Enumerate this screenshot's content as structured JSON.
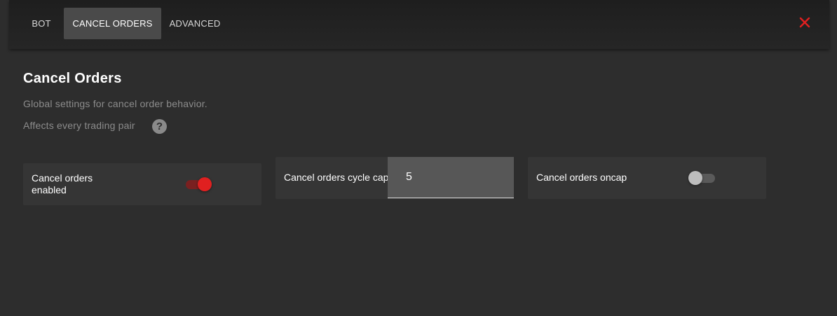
{
  "tabs": [
    {
      "label": "BOT",
      "active": false
    },
    {
      "label": "CANCEL ORDERS",
      "active": true
    },
    {
      "label": "ADVANCED",
      "active": false
    }
  ],
  "close_icon": "close-icon",
  "colors": {
    "accent": "#e02020",
    "background": "#2d2d2d",
    "card": "#353535",
    "input": "#575757"
  },
  "page": {
    "title": "Cancel Orders",
    "description": "Global settings for cancel order behavior.",
    "note": "Affects every trading pair",
    "help_icon": "?"
  },
  "settings": {
    "cancel_enabled": {
      "label": "Cancel orders enabled",
      "value": true
    },
    "cycle_cap": {
      "label": "Cancel orders cycle cap",
      "value": "5"
    },
    "oncap": {
      "label": "Cancel orders oncap",
      "value": false
    }
  }
}
